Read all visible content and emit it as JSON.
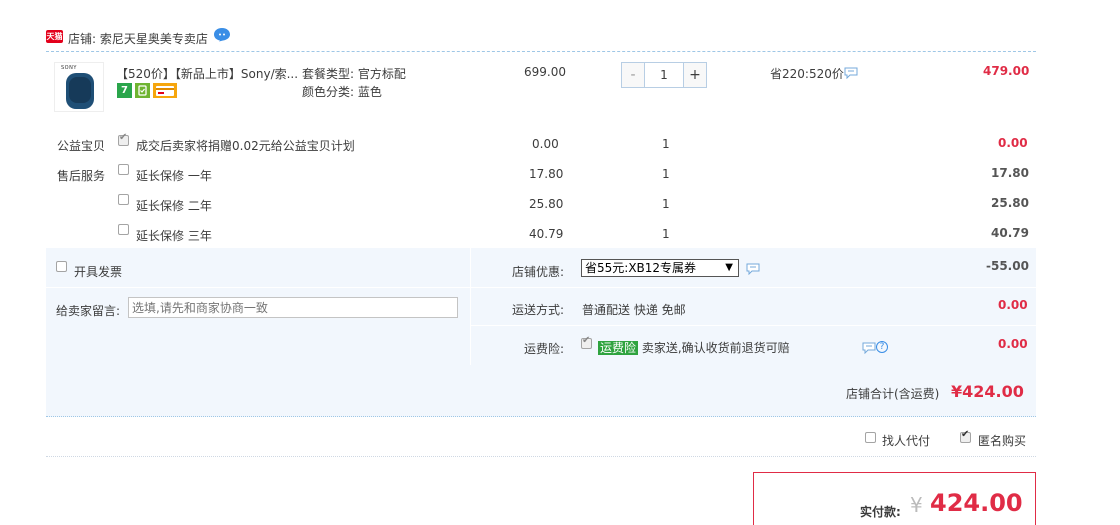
{
  "shop": {
    "badge": "天猫",
    "title": "店铺: 索尼天星奥美专卖店"
  },
  "item": {
    "brand": "SONY",
    "title": "【520价】【新品上市】Sony/索...",
    "sku_type": "套餐类型: 官方标配",
    "sku_color": "颜色分类: 蓝色",
    "unit_price": "699.00",
    "quantity": "1",
    "qty_minus": "-",
    "qty_plus": "+",
    "save": "省220:520价",
    "total": "479.00",
    "badges": {
      "seven_day": "7"
    }
  },
  "services": {
    "charity_label": "公益宝贝",
    "charity_text": "成交后卖家将捐赠0.02元给公益宝贝计划",
    "charity_price": "0.00",
    "charity_qty": "1",
    "charity_total": "0.00",
    "after_sale_label": "售后服务",
    "warranty": [
      {
        "text": "延长保修 一年",
        "price": "17.80",
        "qty": "1",
        "total": "17.80"
      },
      {
        "text": "延长保修 二年",
        "price": "25.80",
        "qty": "1",
        "total": "25.80"
      },
      {
        "text": "延长保修 三年",
        "price": "40.79",
        "qty": "1",
        "total": "40.79"
      }
    ]
  },
  "order": {
    "invoice_label": "开具发票",
    "message_label": "给卖家留言:",
    "message_placeholder": "选填,请先和商家协商一致",
    "coupon_label": "店铺优惠:",
    "coupon_selected": "省55元:XB12专属券",
    "coupon_arrow": "▼",
    "coupon_amount": "-55.00",
    "shipping_label": "运送方式:",
    "shipping_value": "普通配送 快递 免邮",
    "shipping_amount": "0.00",
    "insurance_label": "运费险:",
    "insurance_tag": "运费险",
    "insurance_text": "卖家送,确认收货前退货可赔",
    "insurance_amount": "0.00",
    "help_glyph": "?",
    "shop_total_label": "店铺合计(含运费)",
    "shop_total": "¥424.00",
    "proxy_label": "找人代付",
    "anonymous_label": "匿名购买"
  },
  "payment": {
    "label": "实付款:",
    "currency": "¥",
    "amount": "424.00"
  },
  "colors": {
    "price_red": "#e02c46",
    "panel_bg": "#f2f7fd",
    "tmall_red": "#e3001b",
    "insurance_green": "#2fa33f"
  }
}
